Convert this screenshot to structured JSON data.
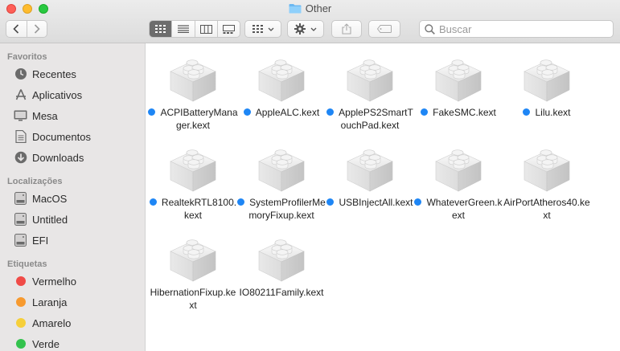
{
  "window": {
    "title": "Other"
  },
  "search": {
    "placeholder": "Buscar"
  },
  "sidebar": {
    "sections": [
      {
        "title": "Favoritos",
        "items": [
          {
            "label": "Recentes",
            "icon": "clock-icon"
          },
          {
            "label": "Aplicativos",
            "icon": "applications-icon"
          },
          {
            "label": "Mesa",
            "icon": "desktop-icon"
          },
          {
            "label": "Documentos",
            "icon": "document-icon"
          },
          {
            "label": "Downloads",
            "icon": "download-icon"
          }
        ]
      },
      {
        "title": "Localizações",
        "items": [
          {
            "label": "MacOS",
            "icon": "disk-icon"
          },
          {
            "label": "Untitled",
            "icon": "disk-icon"
          },
          {
            "label": "EFI",
            "icon": "disk-icon"
          }
        ]
      },
      {
        "title": "Etiquetas",
        "items": [
          {
            "label": "Vermelho",
            "color": "#f04b47"
          },
          {
            "label": "Laranja",
            "color": "#f79a2f"
          },
          {
            "label": "Amarelo",
            "color": "#f6cf3a"
          },
          {
            "label": "Verde",
            "color": "#33c24d"
          }
        ]
      }
    ]
  },
  "files": [
    {
      "name": "ACPIBatteryManager.kext",
      "tagged": true
    },
    {
      "name": "AppleALC.kext",
      "tagged": true
    },
    {
      "name": "ApplePS2SmartTouchPad.kext",
      "tagged": true
    },
    {
      "name": "FakeSMC.kext",
      "tagged": true
    },
    {
      "name": "Lilu.kext",
      "tagged": true
    },
    {
      "name": "RealtekRTL8100.kext",
      "tagged": true
    },
    {
      "name": "SystemProfilerMemoryFixup.kext",
      "tagged": true
    },
    {
      "name": "USBInjectAll.kext",
      "tagged": true
    },
    {
      "name": "WhateverGreen.kext",
      "tagged": true
    },
    {
      "name": "AirPortAtheros40.kext",
      "tagged": false
    },
    {
      "name": "HibernationFixup.kext",
      "tagged": false
    },
    {
      "name": "IO80211Family.kext",
      "tagged": false
    }
  ],
  "colors": {
    "tag_blue": "#1e86f5",
    "accent": "#1e86f5"
  }
}
